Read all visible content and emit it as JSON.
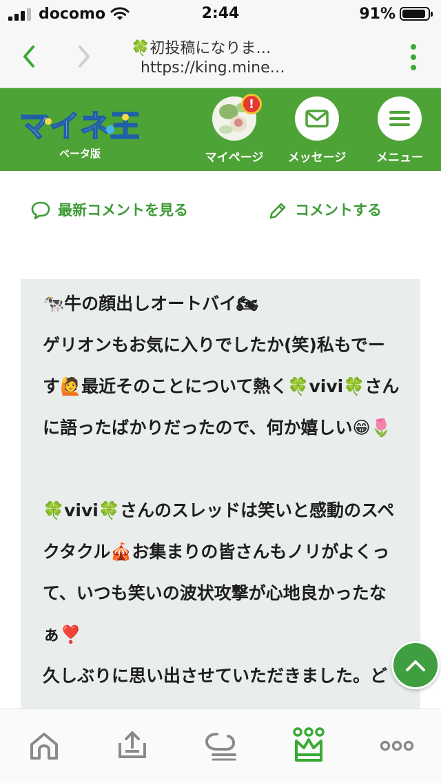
{
  "status_bar": {
    "carrier": "docomo",
    "time": "2:44",
    "battery_percent": "91%",
    "battery_level": 0.91
  },
  "browser": {
    "page_title": "🍀初投稿になりま…",
    "url": "https://king.mine…",
    "back_icon": "chevron-left-icon",
    "forward_icon": "chevron-right-icon",
    "menu_icon": "kebab-icon",
    "accent": "#3aaa35"
  },
  "header": {
    "logo_text": "マイネ王",
    "logo_sub": "ベータ版",
    "background": "#4ea337",
    "items": [
      {
        "label": "マイページ",
        "icon": "avatar",
        "badge": "!"
      },
      {
        "label": "メッセージ",
        "icon": "mail-icon"
      },
      {
        "label": "メニュー",
        "icon": "hamburger-icon"
      }
    ]
  },
  "actions": {
    "latest_comments": "最新コメントを見る",
    "post_comment": "コメントする",
    "color": "#3e9b36"
  },
  "comment": {
    "paragraphs": [
      "🐄牛の顔出しオートバイ🏍\nゲリオンもお気に入りでしたか(笑)私もでーす🙋最近そのことについて熱く🍀vivi🍀さんに語ったばかりだったので、何か嬉しい😁🌷",
      "🍀vivi🍀さんのスレッドは笑いと感動のスペクタクル🎪お集まりの皆さんもノリがよくって、いつも笑いの波状攻撃が心地良かったなぁ❣️"
    ],
    "partial_line": "久しぶりに思い出させていただきました。どうぞ"
  },
  "scroll_top_icon": "chevron-up-icon",
  "tab_bar": {
    "tabs": [
      {
        "icon": "home-icon",
        "active": false
      },
      {
        "icon": "upload-icon",
        "active": false
      },
      {
        "icon": "forum-icon",
        "active": false
      },
      {
        "icon": "crown-icon",
        "active": true
      },
      {
        "icon": "more-icon",
        "active": false
      }
    ],
    "active_color": "#3aaa35",
    "inactive_color": "#8a8a8a"
  }
}
